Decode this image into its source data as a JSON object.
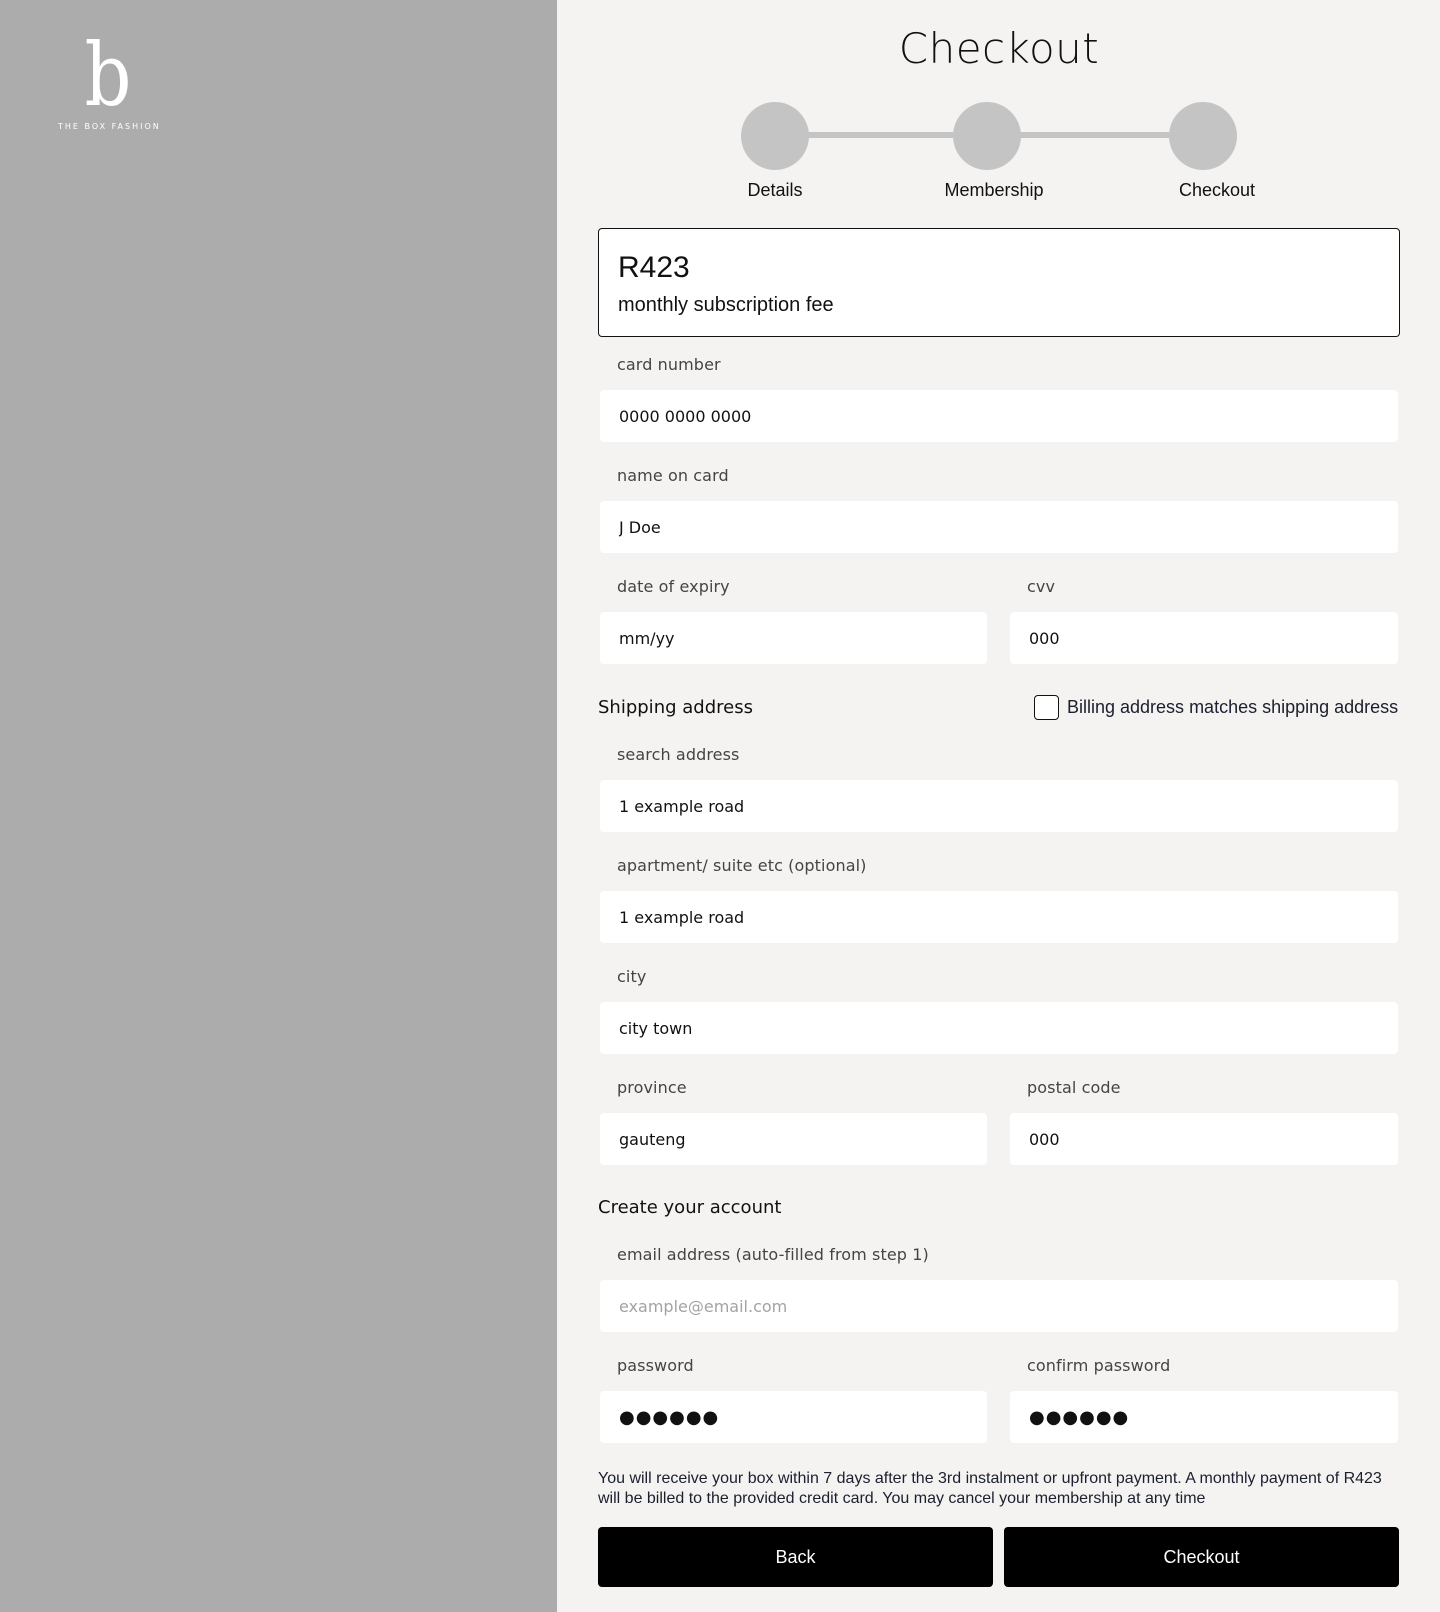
{
  "brand": {
    "logo_mark": "b",
    "logo_text": "THE BOX FASHION"
  },
  "header": {
    "title": "Checkout"
  },
  "stepper": {
    "steps": [
      {
        "label": "Details"
      },
      {
        "label": "Membership"
      },
      {
        "label": "Checkout"
      }
    ]
  },
  "fee": {
    "amount": "R423",
    "caption": "monthly subscription fee"
  },
  "payment": {
    "card_number": {
      "label": "card number",
      "value": "0000 0000 0000"
    },
    "name_on_card": {
      "label": "name on card",
      "value": "J Doe"
    },
    "expiry": {
      "label": "date of expiry",
      "value": "mm/yy"
    },
    "cvv": {
      "label": "cvv",
      "value": "000"
    }
  },
  "shipping": {
    "title": "Shipping address",
    "billing_checkbox": {
      "label": "Billing address matches shipping address",
      "checked": false
    },
    "search_address": {
      "label": "search address",
      "value": "1 example road"
    },
    "apartment": {
      "label": "apartment/ suite etc (optional)",
      "value": "1 example road"
    },
    "city": {
      "label": "city",
      "value": "city town"
    },
    "province": {
      "label": "province",
      "value": "gauteng"
    },
    "postal_code": {
      "label": "postal code",
      "value": "000"
    }
  },
  "account": {
    "title": "Create your account",
    "email": {
      "label": "email address (auto-filled from step 1)",
      "placeholder": "example@email.com"
    },
    "password": {
      "label": "password",
      "value": "●●●●●●"
    },
    "confirm_password": {
      "label": "confirm password",
      "value": "●●●●●●"
    }
  },
  "notice": "You will receive your box within 7 days after the 3rd instalment or upfront payment. A monthly payment of R423 will be billed to the provided credit card. You may cancel your membership at any time",
  "actions": {
    "back_label": "Back",
    "checkout_label": "Checkout"
  }
}
